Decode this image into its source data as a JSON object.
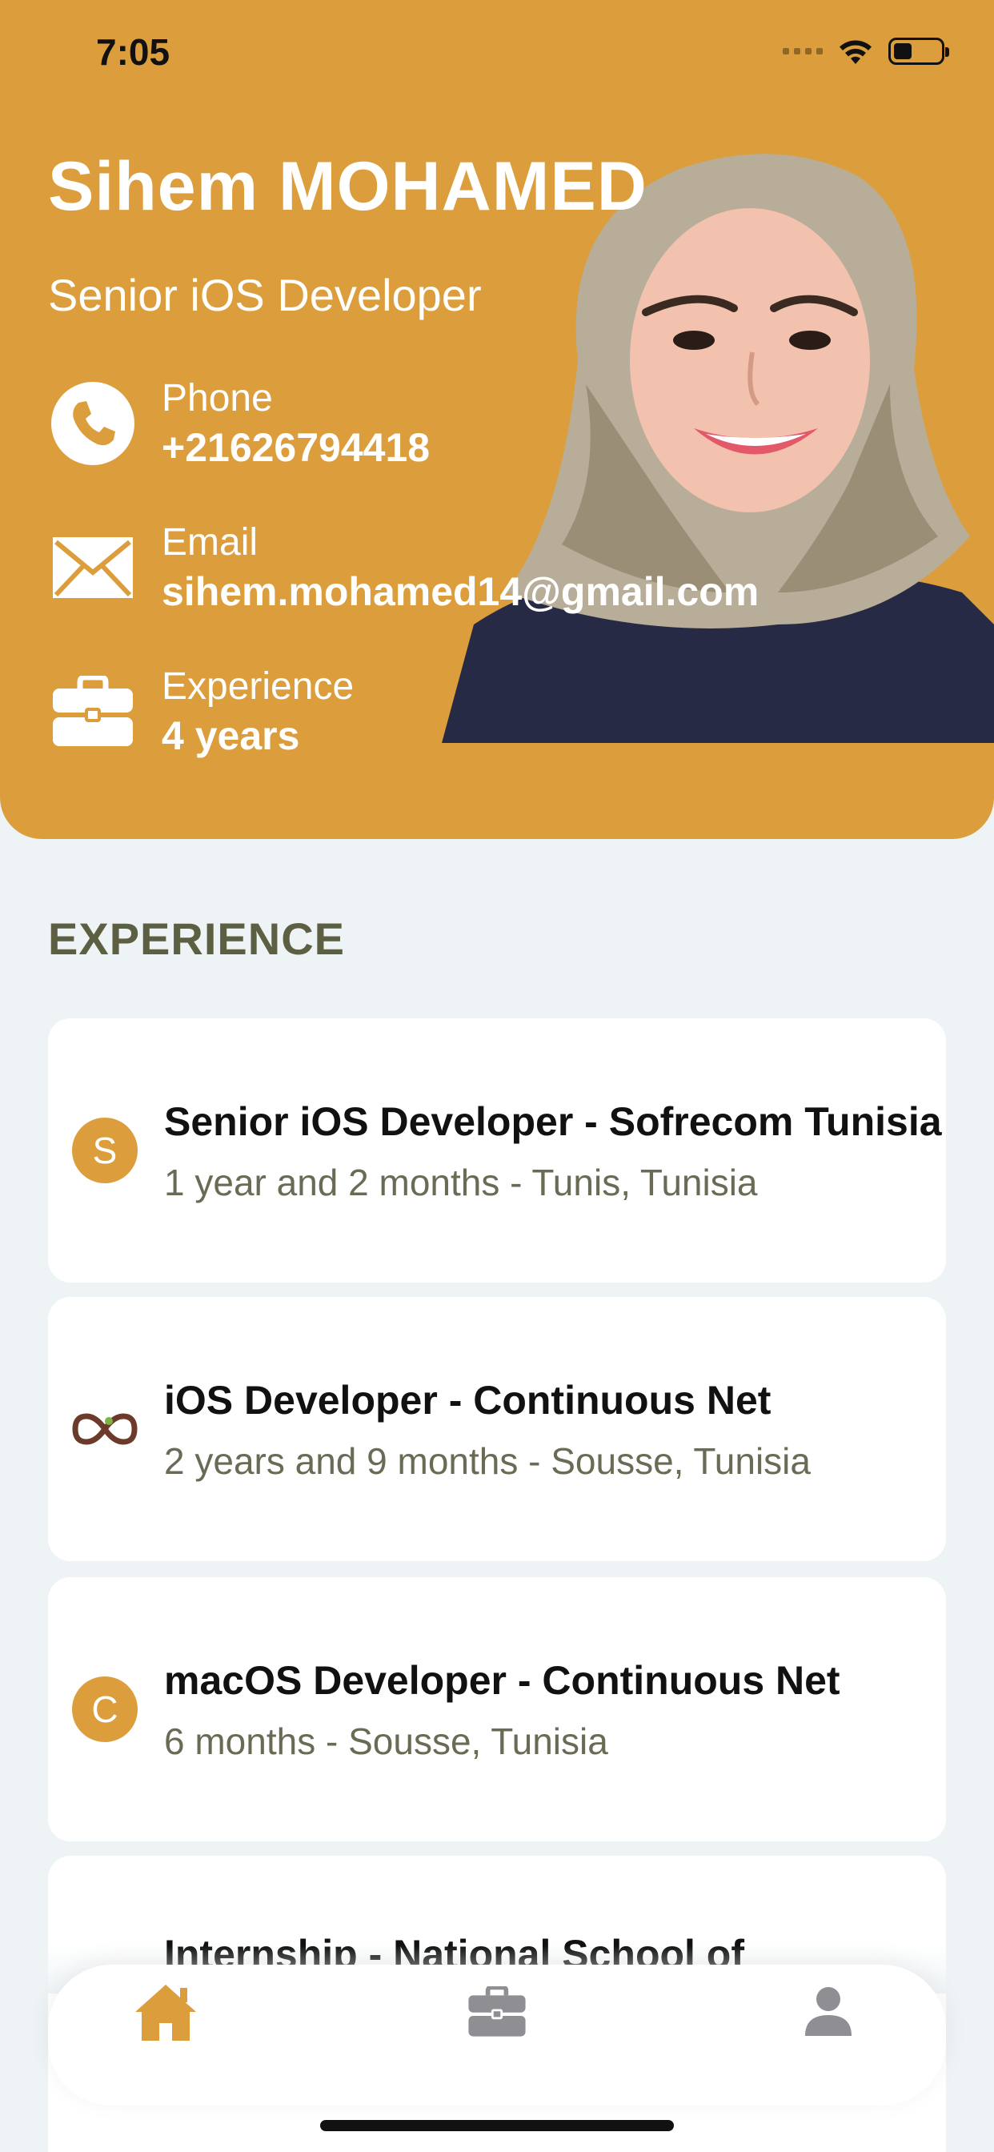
{
  "status_bar": {
    "time": "7:05"
  },
  "profile": {
    "name": "Sihem MOHAMED",
    "role": "Senior iOS Developer",
    "phone": {
      "label": "Phone",
      "value": "+21626794418"
    },
    "email": {
      "label": "Email",
      "value": "sihem.mohamed14@gmail.com"
    },
    "experience": {
      "label": "Experience",
      "value": "4 years"
    }
  },
  "experience_section": {
    "title": "EXPERIENCE",
    "items": [
      {
        "logo_letter": "S",
        "title": "Senior iOS Developer - Sofrecom Tunisia",
        "subtitle": "1 year and 2 months - Tunis, Tunisia"
      },
      {
        "logo_icon": "infinity-logo-icon",
        "title": "iOS Developer - Continuous Net",
        "subtitle": "2 years and 9 months - Sousse, Tunisia"
      },
      {
        "logo_letter": "C",
        "title": "macOS Developer - Continuous Net",
        "subtitle": "6 months - Sousse, Tunisia"
      },
      {
        "logo_letter": "",
        "title": "Internship - National School of",
        "subtitle": ""
      }
    ]
  },
  "tabbar": {
    "tabs": [
      {
        "icon": "home-icon",
        "active": true
      },
      {
        "icon": "briefcase-icon",
        "active": false
      },
      {
        "icon": "person-icon",
        "active": false
      }
    ]
  },
  "colors": {
    "accent": "#dc9e3c",
    "background": "#eef3f6",
    "section_title": "#5d5f43",
    "inactive_tab": "#8e8e93"
  }
}
